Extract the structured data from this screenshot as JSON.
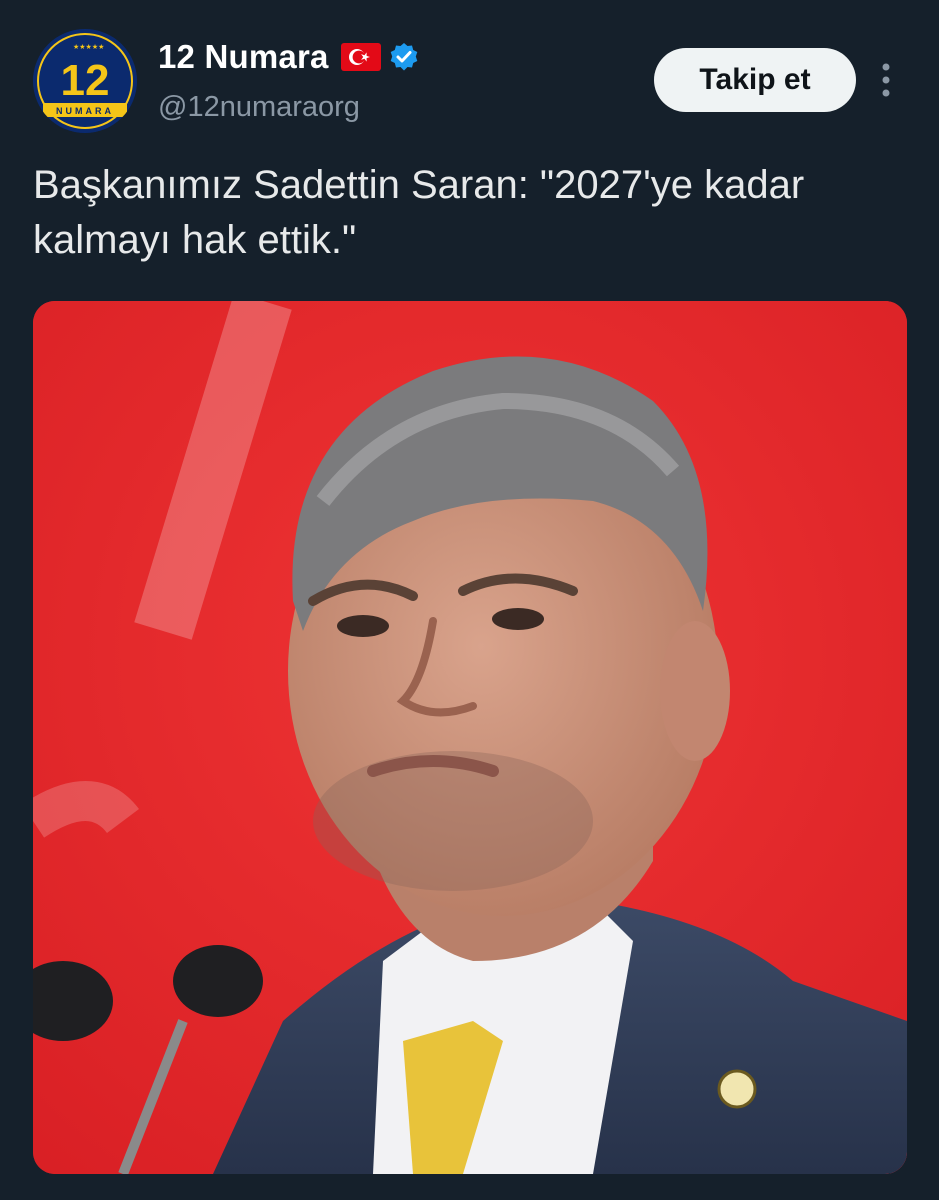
{
  "account": {
    "display_name": "12 Numara",
    "handle": "@12numaraorg",
    "avatar_text": "12",
    "avatar_subtext": "NUMARA",
    "flag": "turkey-flag-icon",
    "verified": "verified-badge-icon"
  },
  "actions": {
    "follow_label": "Takip et",
    "more": "more-options-icon"
  },
  "tweet": {
    "text": "Başkanımız Sadettin Saran: \"2027'ye kadar kalmayı hak ettik.\""
  },
  "colors": {
    "background": "#15202b",
    "photo_background": "#e0282c",
    "verified": "#1d9bf0",
    "follow_button": "#eff3f4",
    "avatar_badge": "#0b2a6e",
    "avatar_accent": "#f5c518"
  }
}
